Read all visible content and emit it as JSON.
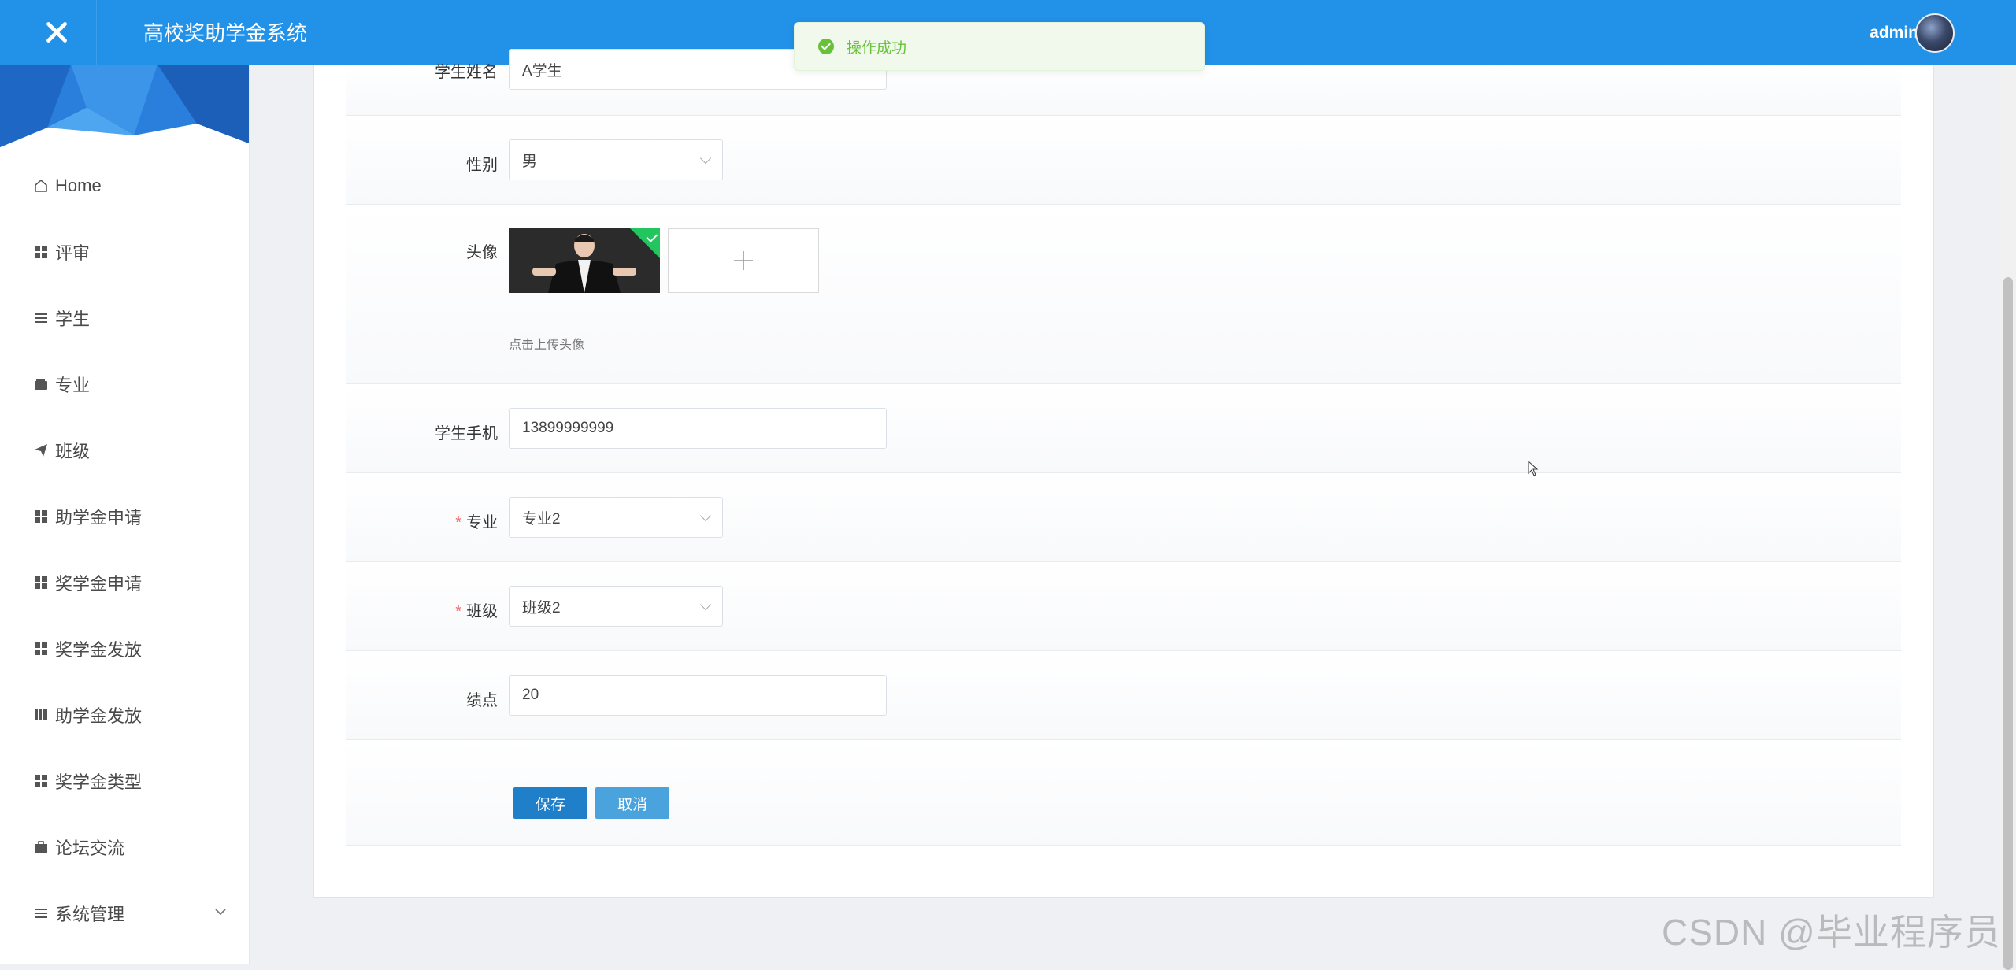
{
  "header": {
    "app_title": "高校奖助学金系统",
    "user_name": "admin",
    "close_icon": "close-icon"
  },
  "toast": {
    "message": "操作成功",
    "status_color": "#67c23a"
  },
  "sidebar": {
    "items": [
      {
        "label": "Home",
        "icon": "home-icon"
      },
      {
        "label": "评审",
        "icon": "grid-icon"
      },
      {
        "label": "学生",
        "icon": "list-icon"
      },
      {
        "label": "专业",
        "icon": "wallet-icon"
      },
      {
        "label": "班级",
        "icon": "send-icon"
      },
      {
        "label": "助学金申请",
        "icon": "grid-icon"
      },
      {
        "label": "奖学金申请",
        "icon": "grid-icon"
      },
      {
        "label": "奖学金发放",
        "icon": "grid-icon"
      },
      {
        "label": "助学金发放",
        "icon": "book-icon"
      },
      {
        "label": "奖学金类型",
        "icon": "grid-icon"
      },
      {
        "label": "论坛交流",
        "icon": "briefcase-icon"
      },
      {
        "label": "系统管理",
        "icon": "list-icon"
      }
    ]
  },
  "form": {
    "name": {
      "label": "学生姓名",
      "value": "A学生"
    },
    "gender": {
      "label": "性别",
      "value": "男"
    },
    "avatar": {
      "label": "头像",
      "hint": "点击上传头像"
    },
    "phone": {
      "label": "学生手机",
      "value": "13899999999"
    },
    "major": {
      "label": "专业",
      "required": "*",
      "value": "专业2"
    },
    "class": {
      "label": "班级",
      "required": "*",
      "value": "班级2"
    },
    "gpa": {
      "label": "绩点",
      "value": "20"
    },
    "save_label": "保存",
    "cancel_label": "取消"
  },
  "colors": {
    "header_bg": "#2291e8",
    "save_btn": "#1f7fc8",
    "cancel_btn": "#4aa3dc",
    "required": "#f56c6c"
  },
  "watermark": "CSDN @毕业程序员"
}
